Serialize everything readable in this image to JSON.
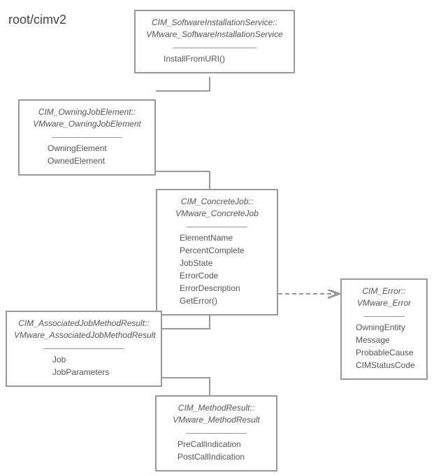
{
  "namespace": "root/cimv2",
  "classes": {
    "softwareInstall": {
      "title1": "CIM_SoftwareInstallationService::",
      "title2": "VMware_SoftwareInstallationService",
      "members": [
        "InstallFromURI()"
      ]
    },
    "owningJob": {
      "title1": "CIM_OwningJobElement::",
      "title2": "VMware_OwningJobElement",
      "members": [
        "OwningElement",
        "OwnedElement"
      ]
    },
    "concreteJob": {
      "title1": "CIM_ConcreteJob::",
      "title2": "VMware_ConcreteJob",
      "members": [
        "ElementName",
        "PercentComplete",
        "JobState",
        "ErrorCode",
        "ErrorDescription",
        "GetError()"
      ]
    },
    "assocJobMethodResult": {
      "title1": "CIM_AssociatedJobMethodResult::",
      "title2": "VMware_AssociatedJobMethodResult",
      "members": [
        "Job",
        "JobParameters"
      ]
    },
    "error": {
      "title1": "CIM_Error::",
      "title2": "VMware_Error",
      "members": [
        "OwningEntity",
        "Message",
        "ProbableCause",
        "CIMStatusCode"
      ]
    },
    "methodResult": {
      "title1": "CIM_MethodResult::",
      "title2": "VMware_MethodResult",
      "members": [
        "PreCallIndication",
        "PostCallIndication"
      ]
    }
  }
}
